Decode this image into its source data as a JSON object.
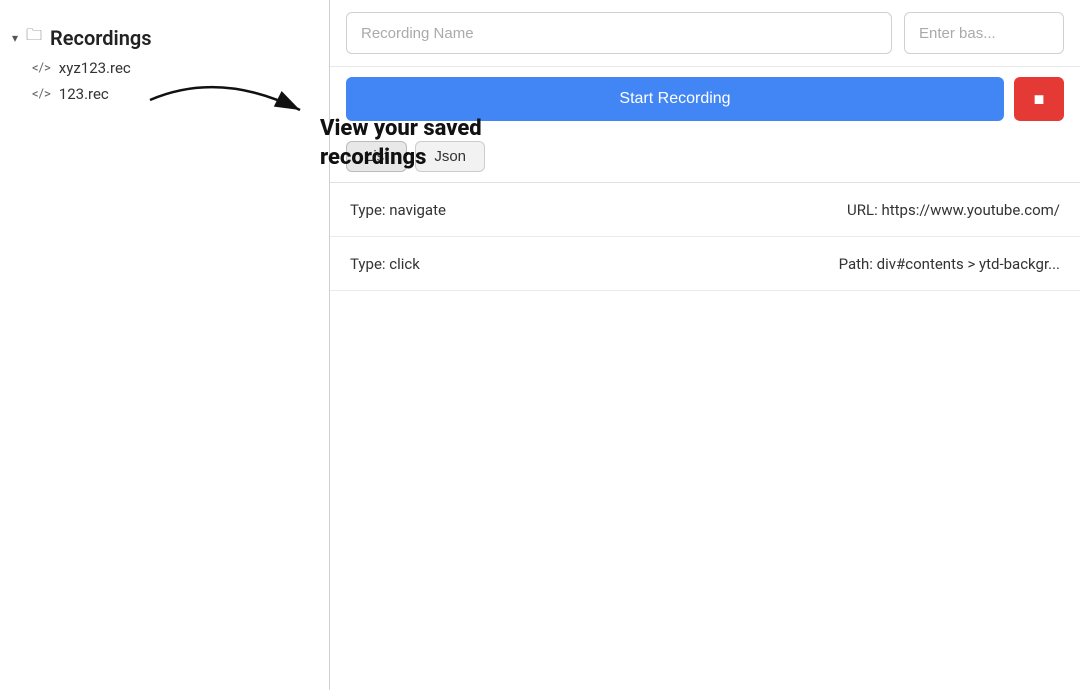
{
  "sidebar": {
    "title": "Recordings",
    "items": [
      {
        "id": "xyz123",
        "label": "xyz123.rec"
      },
      {
        "id": "123",
        "label": "123.rec"
      }
    ]
  },
  "annotation": {
    "text_line1": "View your saved",
    "text_line2": "recordings"
  },
  "topbar": {
    "recording_name_placeholder": "Recording Name",
    "base_url_placeholder": "Enter bas..."
  },
  "actions": {
    "start_recording_label": "Start Recording"
  },
  "tabs": [
    {
      "id": "list",
      "label": "List",
      "active": true
    },
    {
      "id": "json",
      "label": "Json",
      "active": false
    }
  ],
  "entries": [
    {
      "type_label": "Type: navigate",
      "meta_key": "URL:",
      "meta_value": "https://www.youtube.com/"
    },
    {
      "type_label": "Type: click",
      "meta_key": "Path:",
      "meta_value": "div#contents > ytd-backgr..."
    }
  ]
}
